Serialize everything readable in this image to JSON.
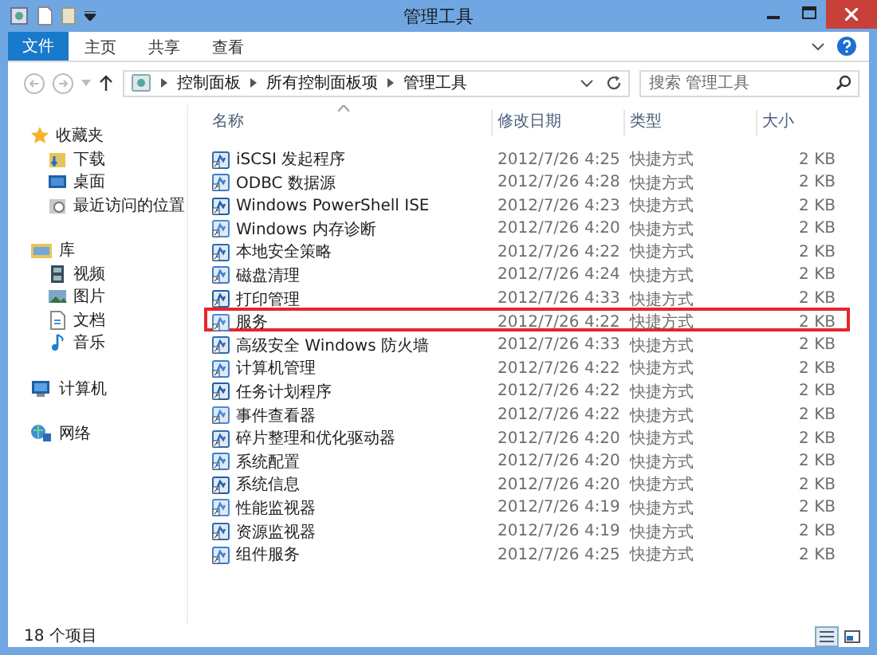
{
  "window": {
    "title": "管理工具"
  },
  "ribbon": {
    "file_button": "文件",
    "tabs": [
      {
        "label": "主页",
        "selected": false
      },
      {
        "label": "共享",
        "selected": false
      },
      {
        "label": "查看",
        "selected": false
      }
    ]
  },
  "address_bar": {
    "path": [
      "控制面板",
      "所有控制面板项",
      "管理工具"
    ],
    "search": {
      "placeholder": "搜索 管理工具"
    }
  },
  "sidebar": {
    "items": [
      {
        "label": "收藏夹",
        "kind": "star",
        "children": [
          {
            "label": "下载",
            "kind": "download"
          },
          {
            "label": "桌面",
            "kind": "desktop"
          },
          {
            "label": "最近访问的位置",
            "kind": "recent"
          }
        ]
      },
      {
        "label": "库",
        "kind": "library",
        "children": [
          {
            "label": "视频",
            "kind": "video"
          },
          {
            "label": "图片",
            "kind": "picture"
          },
          {
            "label": "文档",
            "kind": "document"
          },
          {
            "label": "音乐",
            "kind": "music"
          }
        ]
      },
      {
        "label": "计算机",
        "kind": "computer"
      },
      {
        "label": "网络",
        "kind": "network"
      }
    ]
  },
  "files": {
    "columns": [
      "名称",
      "修改日期",
      "类型",
      "大小"
    ],
    "rows": [
      {
        "name": "iSCSI 发起程序",
        "date": "2012/7/26 4:25",
        "type": "快捷方式",
        "size": "2 KB",
        "highlighted": false
      },
      {
        "name": "ODBC 数据源",
        "date": "2012/7/26 4:28",
        "type": "快捷方式",
        "size": "2 KB",
        "highlighted": false
      },
      {
        "name": "Windows PowerShell ISE",
        "date": "2012/7/26 4:23",
        "type": "快捷方式",
        "size": "2 KB",
        "highlighted": false
      },
      {
        "name": "Windows 内存诊断",
        "date": "2012/7/26 4:20",
        "type": "快捷方式",
        "size": "2 KB",
        "highlighted": false
      },
      {
        "name": "本地安全策略",
        "date": "2012/7/26 4:22",
        "type": "快捷方式",
        "size": "2 KB",
        "highlighted": false
      },
      {
        "name": "磁盘清理",
        "date": "2012/7/26 4:24",
        "type": "快捷方式",
        "size": "2 KB",
        "highlighted": false
      },
      {
        "name": "打印管理",
        "date": "2012/7/26 4:33",
        "type": "快捷方式",
        "size": "2 KB",
        "highlighted": false
      },
      {
        "name": "服务",
        "date": "2012/7/26 4:22",
        "type": "快捷方式",
        "size": "2 KB",
        "highlighted": true
      },
      {
        "name": "高级安全 Windows 防火墙",
        "date": "2012/7/26 4:33",
        "type": "快捷方式",
        "size": "2 KB",
        "highlighted": false
      },
      {
        "name": "计算机管理",
        "date": "2012/7/26 4:22",
        "type": "快捷方式",
        "size": "2 KB",
        "highlighted": false
      },
      {
        "name": "任务计划程序",
        "date": "2012/7/26 4:22",
        "type": "快捷方式",
        "size": "2 KB",
        "highlighted": false
      },
      {
        "name": "事件查看器",
        "date": "2012/7/26 4:22",
        "type": "快捷方式",
        "size": "2 KB",
        "highlighted": false
      },
      {
        "name": "碎片整理和优化驱动器",
        "date": "2012/7/26 4:20",
        "type": "快捷方式",
        "size": "2 KB",
        "highlighted": false
      },
      {
        "name": "系统配置",
        "date": "2012/7/26 4:20",
        "type": "快捷方式",
        "size": "2 KB",
        "highlighted": false
      },
      {
        "name": "系统信息",
        "date": "2012/7/26 4:20",
        "type": "快捷方式",
        "size": "2 KB",
        "highlighted": false
      },
      {
        "name": "性能监视器",
        "date": "2012/7/26 4:19",
        "type": "快捷方式",
        "size": "2 KB",
        "highlighted": false
      },
      {
        "name": "资源监视器",
        "date": "2012/7/26 4:19",
        "type": "快捷方式",
        "size": "2 KB",
        "highlighted": false
      },
      {
        "name": "组件服务",
        "date": "2012/7/26 4:25",
        "type": "快捷方式",
        "size": "2 KB",
        "highlighted": false
      }
    ]
  },
  "status_bar": {
    "text": "18 个项目",
    "views": [
      {
        "selected": true
      },
      {
        "selected": false
      }
    ]
  }
}
